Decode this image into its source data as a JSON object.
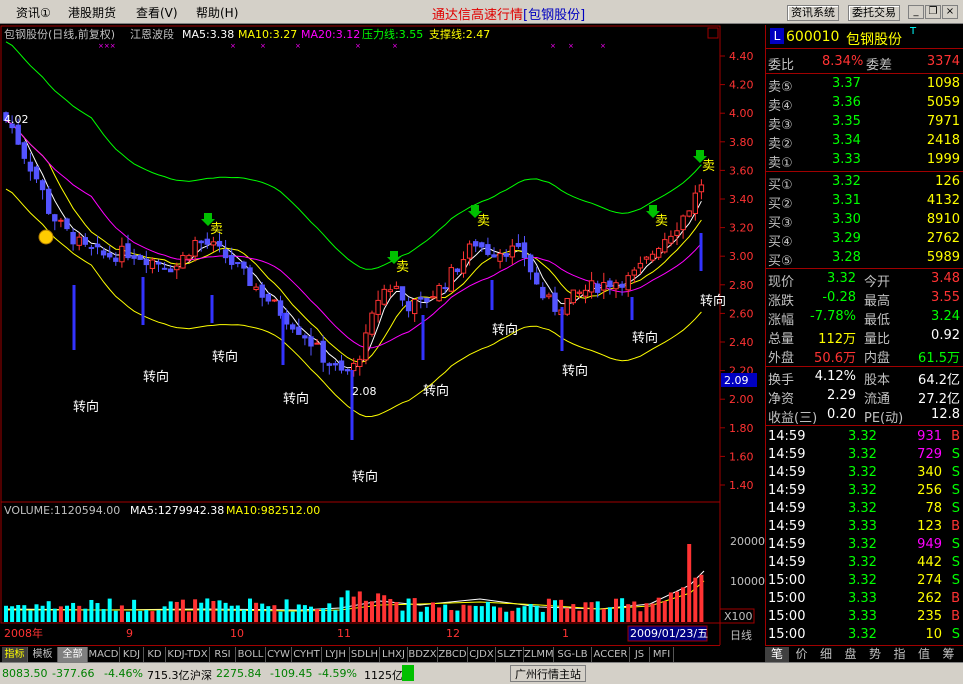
{
  "menu": {
    "items": [
      "资讯①",
      "港股期货",
      "查看(V)",
      "帮助(H)"
    ],
    "title_prefix": "通达信高速行情",
    "title_stock": "[包钢股份]",
    "btn_info": "资讯系统",
    "btn_trade": "委托交易"
  },
  "chart": {
    "header_name": "包钢股份(日线,前复权)",
    "indicator": "江恩波段",
    "ma5": "MA5:3.38",
    "ma10": "MA10:3.27",
    "ma20": "MA20:3.12",
    "pressure": "压力线:3.55",
    "support": "支撑线:2.47",
    "volume_header": "VOLUME:1120594.00",
    "vol_ma5": "MA5:1279942.38",
    "vol_ma10": "MA10:982512.00",
    "vol_multiplier": "X100",
    "current_price_tag": "2.09",
    "date_box": "2009/01/23/五",
    "period_label": "日线",
    "high_label": "4.02",
    "low_label": "2.08",
    "x_labels": [
      "2008年",
      "9",
      "10",
      "11",
      "12",
      "1"
    ],
    "zhuanxiang_label": "转向",
    "sell_label": "卖",
    "buy_marker": "😀",
    "price_axis": [
      "4.40",
      "4.20",
      "4.00",
      "3.80",
      "3.60",
      "3.40",
      "3.20",
      "3.00",
      "2.80",
      "2.60",
      "2.40",
      "2.20",
      "2.00",
      "1.80",
      "1.60",
      "1.40"
    ],
    "volume_axis": [
      "20000",
      "10000"
    ]
  },
  "quote": {
    "code_badge": "L",
    "code": "600010",
    "name": "包钢股份",
    "name_suffix": "T",
    "weibi_label": "委比",
    "weibi_value": "8.34%",
    "weicha_label": "委差",
    "weicha_value": "3374",
    "asks": [
      {
        "label": "卖⑤",
        "price": "3.37",
        "vol": "1098"
      },
      {
        "label": "卖④",
        "price": "3.36",
        "vol": "5059"
      },
      {
        "label": "卖③",
        "price": "3.35",
        "vol": "7971"
      },
      {
        "label": "卖②",
        "price": "3.34",
        "vol": "2418"
      },
      {
        "label": "卖①",
        "price": "3.33",
        "vol": "1999"
      }
    ],
    "bids": [
      {
        "label": "买①",
        "price": "3.32",
        "vol": "126"
      },
      {
        "label": "买②",
        "price": "3.31",
        "vol": "4132"
      },
      {
        "label": "买③",
        "price": "3.30",
        "vol": "8910"
      },
      {
        "label": "买④",
        "price": "3.29",
        "vol": "2762"
      },
      {
        "label": "买⑤",
        "price": "3.28",
        "vol": "5989"
      }
    ],
    "stats": [
      {
        "l1": "现价",
        "v1": "3.32",
        "c1": "#00ff00",
        "l2": "今开",
        "v2": "3.48",
        "c2": "#ff3333"
      },
      {
        "l1": "涨跌",
        "v1": "-0.28",
        "c1": "#00ff00",
        "l2": "最高",
        "v2": "3.55",
        "c2": "#ff3333"
      },
      {
        "l1": "涨幅",
        "v1": "-7.78%",
        "c1": "#00ff00",
        "l2": "最低",
        "v2": "3.24",
        "c2": "#00ff00"
      },
      {
        "l1": "总量",
        "v1": "112万",
        "c1": "#ffff00",
        "l2": "量比",
        "v2": "0.92",
        "c2": "#ffffff"
      },
      {
        "l1": "外盘",
        "v1": "50.6万",
        "c1": "#ff3333",
        "l2": "内盘",
        "v2": "61.5万",
        "c2": "#00ff00"
      }
    ],
    "fundamentals": [
      {
        "l1": "换手",
        "v1": "4.12%",
        "l2": "股本",
        "v2": "64.2亿"
      },
      {
        "l1": "净资",
        "v1": "2.29",
        "l2": "流通",
        "v2": "27.2亿"
      },
      {
        "l1": "收益(三)",
        "v1": "0.20",
        "l2": "PE(动)",
        "v2": "12.8"
      }
    ],
    "ticks": [
      {
        "time": "14:59",
        "price": "3.32",
        "vol": "931",
        "side": "B",
        "vc": "#ff00ff"
      },
      {
        "time": "14:59",
        "price": "3.32",
        "vol": "729",
        "side": "S",
        "vc": "#ff00ff"
      },
      {
        "time": "14:59",
        "price": "3.32",
        "vol": "340",
        "side": "S",
        "vc": "#ffff00"
      },
      {
        "time": "14:59",
        "price": "3.32",
        "vol": "256",
        "side": "S",
        "vc": "#ffff00"
      },
      {
        "time": "14:59",
        "price": "3.32",
        "vol": "78",
        "side": "S",
        "vc": "#ffff00"
      },
      {
        "time": "14:59",
        "price": "3.33",
        "vol": "123",
        "side": "B",
        "vc": "#ffff00"
      },
      {
        "time": "14:59",
        "price": "3.32",
        "vol": "949",
        "side": "S",
        "vc": "#ff00ff"
      },
      {
        "time": "14:59",
        "price": "3.32",
        "vol": "442",
        "side": "S",
        "vc": "#ffff00"
      },
      {
        "time": "15:00",
        "price": "3.32",
        "vol": "274",
        "side": "S",
        "vc": "#ffff00"
      },
      {
        "time": "15:00",
        "price": "3.33",
        "vol": "262",
        "side": "B",
        "vc": "#ffff00"
      },
      {
        "time": "15:00",
        "price": "3.33",
        "vol": "235",
        "side": "B",
        "vc": "#ffff00"
      },
      {
        "time": "15:00",
        "price": "3.32",
        "vol": "10",
        "side": "S",
        "vc": "#ffff00"
      }
    ]
  },
  "tabs": [
    "指标",
    "模板",
    "全部",
    "MACD",
    "KDJ",
    "KD",
    "KDJ-TDX",
    "RSI",
    "BOLL",
    "CYW",
    "CYHT",
    "LYJH",
    "SDLH",
    "LHXJ",
    "BDZX",
    "ZBCD",
    "CJDX",
    "SLZT",
    "ZLMM",
    "SG-LB",
    "ACCER",
    "JS",
    "MFI"
  ],
  "right_tabs": [
    "笔",
    "价",
    "细",
    "盘",
    "势",
    "指",
    "值",
    "筹"
  ],
  "status": {
    "sh_index": "8083.50",
    "sh_change": "-377.66",
    "sh_pct": "-4.46%",
    "sh_amount": "715.3亿",
    "hs_label": "沪深",
    "hs_index": "2275.84",
    "hs_change": "-109.45",
    "hs_pct": "-4.59%",
    "hs_amount": "1125亿",
    "station": "广州行情主站"
  },
  "colors": {
    "up": "#ff3333",
    "down": "#00ff00",
    "ma5": "#ffffff",
    "ma10": "#ffff00",
    "ma20": "#ff00ff",
    "pressure": "#00ff00",
    "support": "#ffff00"
  }
}
